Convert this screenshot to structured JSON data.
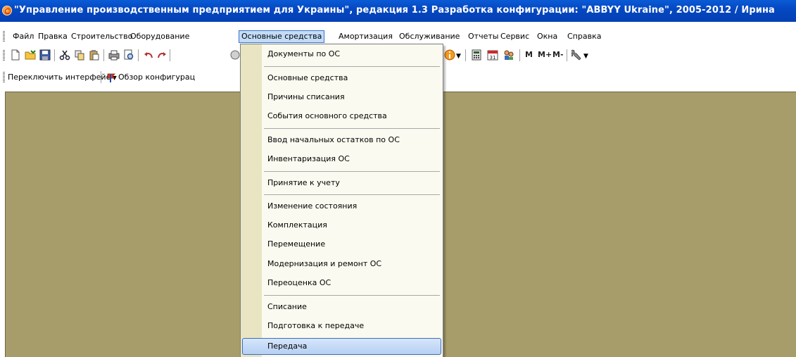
{
  "window": {
    "title": "\"Управление производственным предприятием для Украины\", редакция 1.3 Разработка конфигурации: \"ABBYY Ukraine\", 2005-2012 / Ирина"
  },
  "menubar": {
    "items": [
      {
        "label": "Файл"
      },
      {
        "label": "Правка"
      },
      {
        "label": "Строительство"
      },
      {
        "label": "Оборудование"
      },
      {
        "label": "Основные средства",
        "active": true
      },
      {
        "label": "Амортизация"
      },
      {
        "label": "Обслуживание"
      },
      {
        "label": "Отчеты"
      },
      {
        "label": "Сервис"
      },
      {
        "label": "Окна"
      },
      {
        "label": "Справка"
      }
    ]
  },
  "toolbar2": {
    "switch_interface": "Переключить интерфейс",
    "config_overview": "Обзор конфигурац"
  },
  "toolbar1": {
    "m": "M",
    "m_plus": "M+",
    "m_minus": "M-"
  },
  "dropdown": {
    "items": [
      "Документы по ОС",
      "Основные средства",
      "Причины списания",
      "События основного средства",
      "Ввод начальных остатков по ОС",
      "Инвентаризация ОС",
      "Принятие к учету",
      "Изменение состояния",
      "Комплектация",
      "Перемещение",
      "Модернизация и ремонт ОС",
      "Переоценка ОС",
      "Списание",
      "Подготовка к передаче",
      "Передача"
    ],
    "highlighted": "Передача"
  },
  "colors": {
    "titlebar": "#0548c2",
    "workarea": "#a79d6b",
    "menu_bg": "#fbfaf0",
    "menu_highlight": "#c2dcf8"
  }
}
